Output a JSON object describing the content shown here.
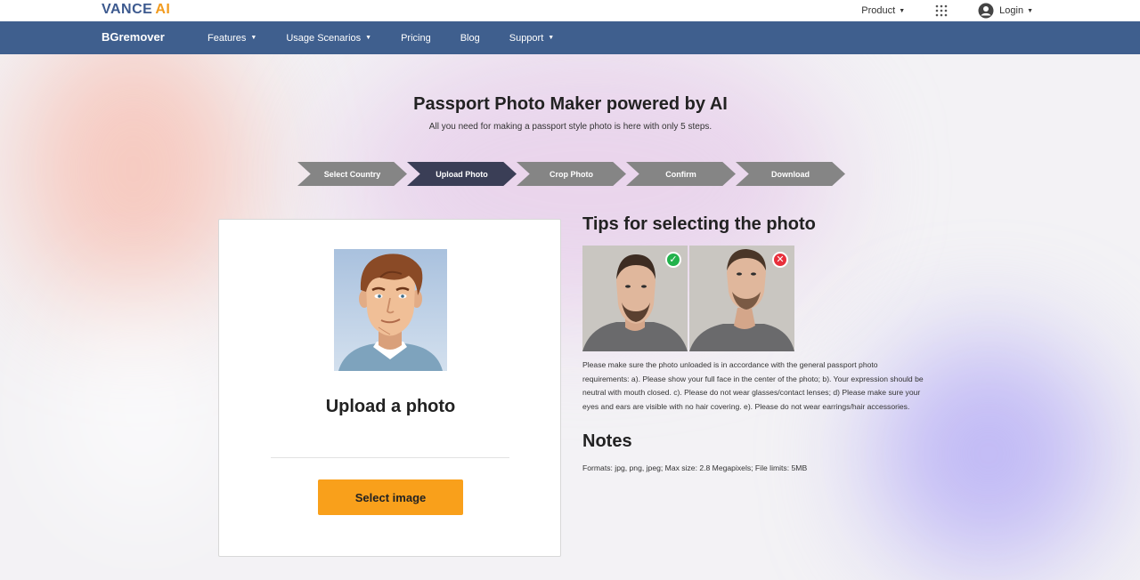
{
  "topbar": {
    "logo_main": "VANCE",
    "logo_ai": "AI",
    "product_label": "Product",
    "login_label": "Login"
  },
  "navbar": {
    "brand": "BGremover",
    "items": [
      {
        "label": "Features"
      },
      {
        "label": "Usage Scenarios"
      },
      {
        "label": "Pricing"
      },
      {
        "label": "Blog"
      },
      {
        "label": "Support"
      }
    ]
  },
  "header": {
    "title": "Passport Photo Maker powered by AI",
    "subtitle": "All you need for making a passport style photo is here with only 5 steps."
  },
  "steps": [
    {
      "label": "Select Country",
      "active": false
    },
    {
      "label": "Upload Photo",
      "active": true
    },
    {
      "label": "Crop Photo",
      "active": false
    },
    {
      "label": "Confirm",
      "active": false
    },
    {
      "label": "Download",
      "active": false
    }
  ],
  "upload": {
    "title": "Upload a photo",
    "button_label": "Select image"
  },
  "tips": {
    "title": "Tips for selecting the photo",
    "good_badge": "✓",
    "bad_badge": "✕",
    "text": "Please make sure the photo unloaded is in accordance with the general passport photo requirements: a). Please show your full face in the center of the photo; b). Your expression should be neutral with mouth closed. c). Please do not wear glasses/contact lenses; d) Please make sure your eyes and ears are visible with no hair covering. e). Please do not wear earrings/hair accessories."
  },
  "notes": {
    "title": "Notes",
    "text": "Formats: jpg, png, jpeg; Max size: 2.8 Megapixels; File limits: 5MB"
  },
  "colors": {
    "nav_bg": "#3f5f8e",
    "accent_orange": "#f9a01b",
    "step_active": "#3a3e56",
    "step_inactive": "#858585",
    "ok_green": "#22b24c",
    "bad_red": "#e8303c"
  }
}
